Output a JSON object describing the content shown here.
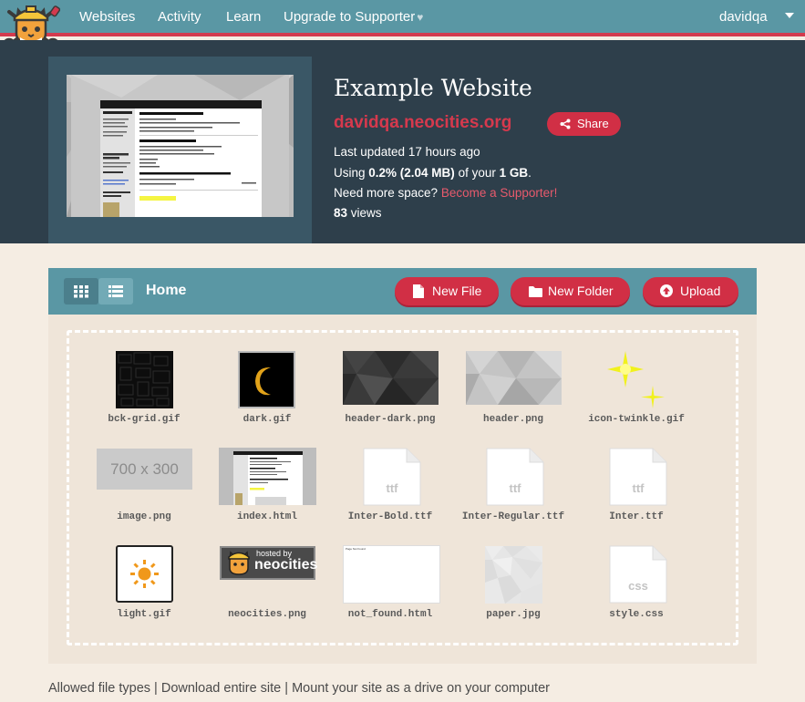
{
  "nav": {
    "items": [
      "Websites",
      "Activity",
      "Learn",
      "Upgrade to Supporter"
    ],
    "username": "davidqa"
  },
  "site": {
    "title": "Example Website",
    "url": "davidqa.neocities.org",
    "share_label": "Share",
    "updated": "Last updated 17 hours ago",
    "usage_prefix": "Using ",
    "usage_value": "0.2% (2.04 MB)",
    "usage_middle": " of your ",
    "usage_quota": "1 GB",
    "usage_suffix": ".",
    "space_text": "Need more space? ",
    "space_link": "Become a Supporter!",
    "views_count": "83",
    "views_label": " views",
    "preview": {
      "menu": [
        "Home",
        "Link",
        "Link",
        "Link",
        "Link"
      ],
      "sidebar_title": "Sidebar",
      "main_heading": "This is the main heading!",
      "second_heading": "A secondary heading!",
      "third_heading": "An H3 heading! Now we're deep into it.",
      "side_heading": "Another heading"
    }
  },
  "file_manager": {
    "breadcrumb": "Home",
    "buttons": {
      "new_file": "New File",
      "new_folder": "New Folder",
      "upload": "Upload"
    },
    "files": [
      {
        "name": "bck-grid.gif",
        "thumb": "bck-grid"
      },
      {
        "name": "dark.gif",
        "thumb": "dark"
      },
      {
        "name": "header-dark.png",
        "thumb": "header-dark"
      },
      {
        "name": "header.png",
        "thumb": "header"
      },
      {
        "name": "icon-twinkle.gif",
        "thumb": "twinkle"
      },
      {
        "name": "image.png",
        "thumb": "placeholder",
        "thumb_text": "700 x 300"
      },
      {
        "name": "index.html",
        "thumb": "index"
      },
      {
        "name": "Inter-Bold.ttf",
        "thumb": "doc",
        "ext": "ttf"
      },
      {
        "name": "Inter-Regular.ttf",
        "thumb": "doc",
        "ext": "ttf"
      },
      {
        "name": "Inter.ttf",
        "thumb": "doc",
        "ext": "ttf"
      },
      {
        "name": "light.gif",
        "thumb": "light"
      },
      {
        "name": "neocities.png",
        "thumb": "neocities",
        "thumb_text": [
          "hosted by",
          "neocities"
        ]
      },
      {
        "name": "not_found.html",
        "thumb": "notfound",
        "thumb_text": "Page Not Found"
      },
      {
        "name": "paper.jpg",
        "thumb": "paper"
      },
      {
        "name": "style.css",
        "thumb": "doc",
        "ext": "css"
      }
    ]
  },
  "footer": {
    "allowed": "Allowed file types",
    "download": "Download entire site",
    "mount": "Mount your site as a drive on your computer",
    "separator": " | "
  },
  "colors": {
    "nav_bg": "#5a97a4",
    "accent": "#d12f45",
    "header_bg": "#2e3f4b",
    "page_bg": "#f5ede3"
  }
}
